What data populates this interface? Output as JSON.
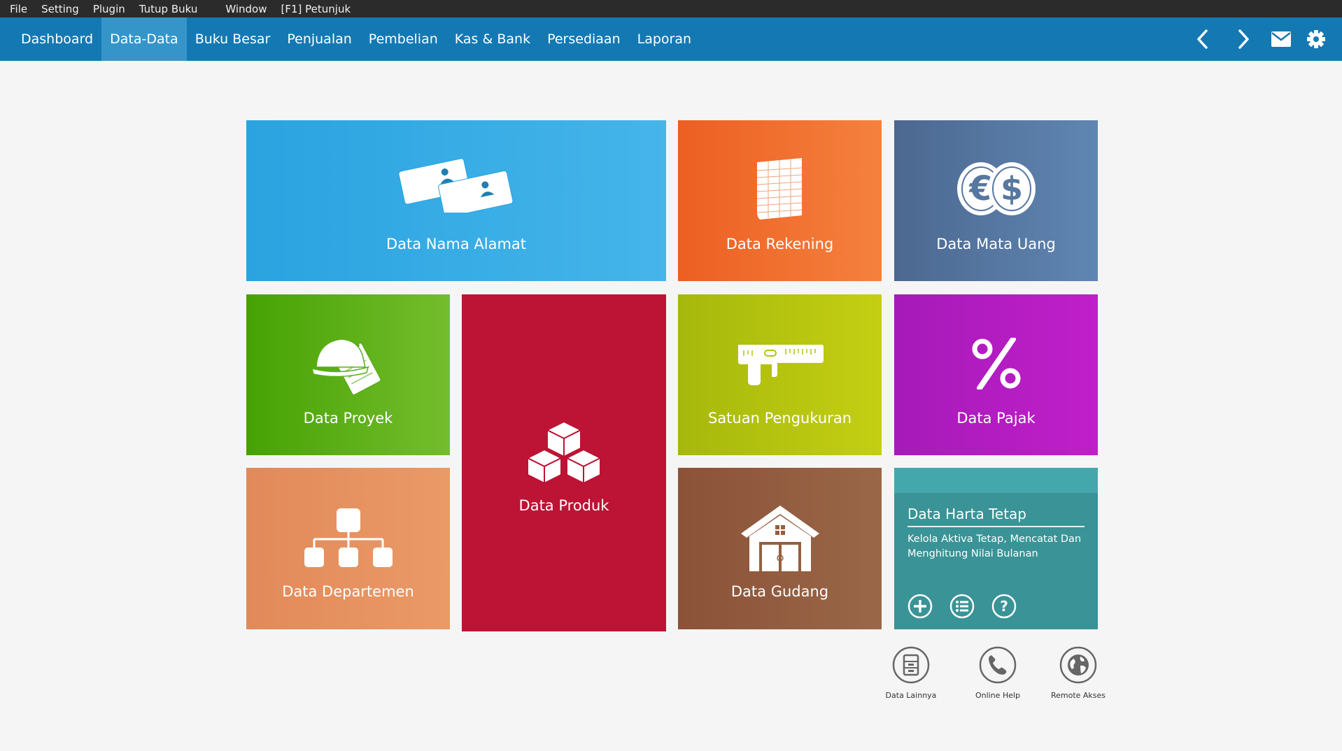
{
  "menubar": {
    "items": [
      "File",
      "Setting",
      "Plugin",
      "Tutup Buku",
      "Window",
      "[F1] Petunjuk"
    ]
  },
  "navbar": {
    "tabs": [
      "Dashboard",
      "Data-Data",
      "Buku Besar",
      "Penjualan",
      "Pembelian",
      "Kas & Bank",
      "Persediaan",
      "Laporan"
    ],
    "active_tab": "Data-Data",
    "icons": [
      "chevron-left-icon",
      "chevron-right-icon",
      "mail-icon",
      "gear-icon"
    ]
  },
  "tiles": {
    "nama_alamat": {
      "label": "Data Nama Alamat",
      "icon": "business-cards-icon",
      "color": "#2aa3e0"
    },
    "rekening": {
      "label": "Data Rekening",
      "icon": "ledger-sheet-icon",
      "color": "#ec5f22"
    },
    "mata_uang": {
      "label": "Data Mata Uang",
      "icon": "currency-coins-icon",
      "color": "#4c6890"
    },
    "proyek": {
      "label": "Data Proyek",
      "icon": "hardhat-notepad-icon",
      "color": "#46a204"
    },
    "produk": {
      "label": "Data Produk",
      "icon": "boxes-icon",
      "color": "#bd1334"
    },
    "satuan": {
      "label": "Satuan Pengukuran",
      "icon": "caliper-icon",
      "color": "#a6b80c"
    },
    "pajak": {
      "label": "Data Pajak",
      "icon": "percent-icon",
      "color": "#a61ab9"
    },
    "departemen": {
      "label": "Data Departemen",
      "icon": "org-chart-icon",
      "color": "#e2895a"
    },
    "gudang": {
      "label": "Data Gudang",
      "icon": "warehouse-icon",
      "color": "#8b5238"
    },
    "harta_tetap": {
      "title": "Data Harta Tetap",
      "description": "Kelola Aktiva Tetap, Mencatat Dan Menghitung Nilai Bulanan",
      "color": "#3a9396",
      "buttons": [
        "plus-circle-icon",
        "list-circle-icon",
        "help-circle-icon"
      ]
    }
  },
  "bottom_links": [
    {
      "label": "Data Lainnya",
      "icon": "cabinet-icon"
    },
    {
      "label": "Online Help",
      "icon": "phone-icon"
    },
    {
      "label": "Remote Akses",
      "icon": "globe-icon"
    }
  ]
}
